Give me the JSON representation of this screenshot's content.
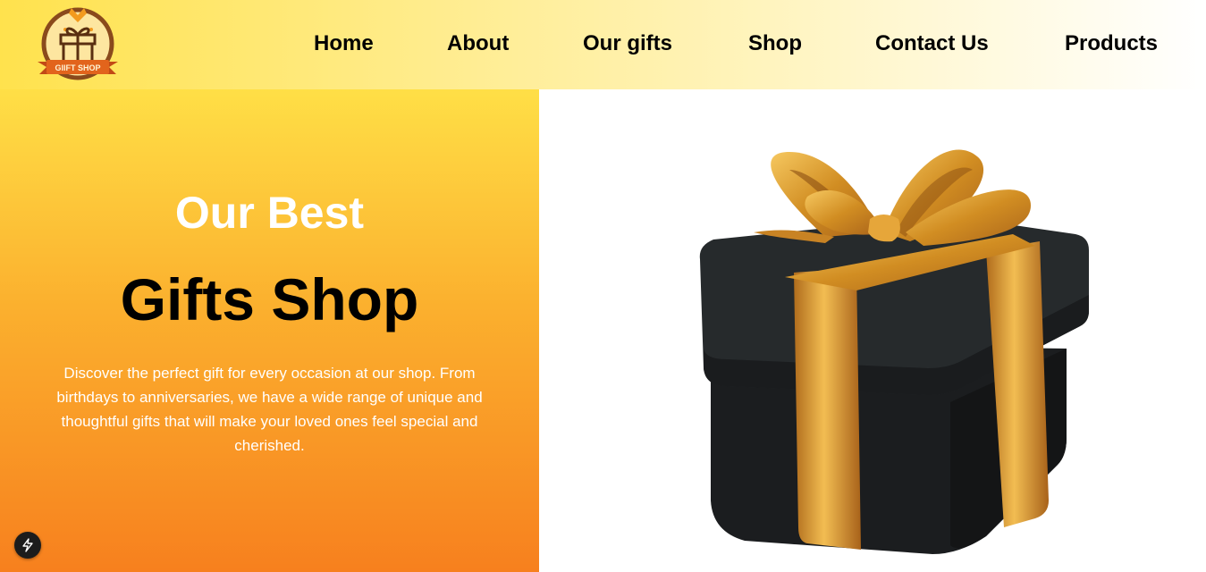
{
  "logo": {
    "text": "GIIFT SHOP"
  },
  "nav": {
    "home": "Home",
    "about": "About",
    "our_gifts": "Our gifts",
    "shop": "Shop",
    "contact": "Contact Us",
    "products": "Products"
  },
  "hero": {
    "subtitle": "Our Best",
    "title": "Gifts Shop",
    "description": "Discover the perfect gift for every occasion at our shop. From birthdays to anniversaries, we have a wide range of unique and thoughtful gifts that will make your loved ones feel special and cherished."
  },
  "colors": {
    "nav_start": "#ffe24d",
    "hero_top": "#ffdf46",
    "hero_bottom": "#f7801e",
    "box": "#1f2224",
    "ribbon": "#d9972c"
  },
  "icons": {
    "logo": "gift-box-icon",
    "fab": "lightning-bolt-icon"
  }
}
